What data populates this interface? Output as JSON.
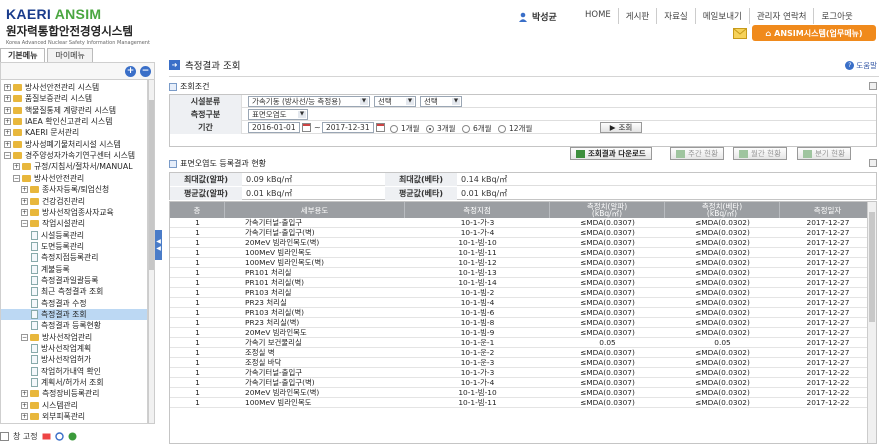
{
  "header": {
    "logo_main_kaeri": "KAERI",
    "logo_main_ansim": "ANSIM",
    "logo_kr": "원자력통합안전경영시스템",
    "logo_sub": "Korea Advanced Nuclear Safety Information Management",
    "user_name": "박성균",
    "nav": [
      "HOME",
      "게시판",
      "자료실",
      "메일보내기",
      "관리자 연락처",
      "로그아웃"
    ],
    "ansim_button": "ANSIM시스템(업무메뉴)"
  },
  "sidebar": {
    "tabs": [
      "기본메뉴",
      "마이메뉴"
    ],
    "add_label": "+",
    "remove_label": "−",
    "items": [
      {
        "label": "방사선안전관리 시스템",
        "indent": 0,
        "type": "folder",
        "toggle": "+"
      },
      {
        "label": "품질보증관리 시스템",
        "indent": 0,
        "type": "folder",
        "toggle": "+"
      },
      {
        "label": "핵물질통제 계량관리 시스템",
        "indent": 0,
        "type": "folder",
        "toggle": "+"
      },
      {
        "label": "IAEA 확인신고관리 시스템",
        "indent": 0,
        "type": "folder",
        "toggle": "+"
      },
      {
        "label": "KAERI 문서관리",
        "indent": 0,
        "type": "folder",
        "toggle": "+"
      },
      {
        "label": "방사성폐기물처리시설 시스템",
        "indent": 0,
        "type": "folder",
        "toggle": "+"
      },
      {
        "label": "경주양성자가속기연구센터 시스템",
        "indent": 0,
        "type": "folder",
        "toggle": "−"
      },
      {
        "label": "규정/지침서/절차서/MANUAL",
        "indent": 1,
        "type": "folder",
        "toggle": "+"
      },
      {
        "label": "방사선안전관리",
        "indent": 1,
        "type": "folder",
        "toggle": "−"
      },
      {
        "label": "종사자등록/퇴업신청",
        "indent": 2,
        "type": "folder",
        "toggle": "+"
      },
      {
        "label": "건강검진관리",
        "indent": 2,
        "type": "folder",
        "toggle": "+"
      },
      {
        "label": "방사선작업종사자교육",
        "indent": 2,
        "type": "folder",
        "toggle": "+"
      },
      {
        "label": "작업시설관리",
        "indent": 2,
        "type": "folder",
        "toggle": "−"
      },
      {
        "label": "시설등록관리",
        "indent": 3,
        "type": "doc"
      },
      {
        "label": "도면등록관리",
        "indent": 3,
        "type": "doc"
      },
      {
        "label": "측정지점등록관리",
        "indent": 3,
        "type": "doc"
      },
      {
        "label": "계불등록",
        "indent": 3,
        "type": "doc"
      },
      {
        "label": "측정결과일괄등록",
        "indent": 3,
        "type": "doc"
      },
      {
        "label": "최근 측정결과 조회",
        "indent": 3,
        "type": "doc"
      },
      {
        "label": "측정결과 수정",
        "indent": 3,
        "type": "doc"
      },
      {
        "label": "측정결과 조회",
        "indent": 3,
        "type": "doc",
        "selected": true
      },
      {
        "label": "측정결과 등록현황",
        "indent": 3,
        "type": "doc"
      },
      {
        "label": "방사선작업관리",
        "indent": 2,
        "type": "folder",
        "toggle": "−"
      },
      {
        "label": "방사선작업계획",
        "indent": 3,
        "type": "doc"
      },
      {
        "label": "방사선작업허가",
        "indent": 3,
        "type": "doc"
      },
      {
        "label": "작업허가내역 확인",
        "indent": 3,
        "type": "doc"
      },
      {
        "label": "계획서/허가서 조회",
        "indent": 3,
        "type": "doc"
      },
      {
        "label": "측정장비등록관리",
        "indent": 2,
        "type": "folder",
        "toggle": "+"
      },
      {
        "label": "시스템관리",
        "indent": 2,
        "type": "folder",
        "toggle": "+"
      },
      {
        "label": "외부피폭관리",
        "indent": 2,
        "type": "folder",
        "toggle": "+"
      }
    ],
    "footer_label": "창 고정"
  },
  "main": {
    "title": "측정결과 조회",
    "help": "도움말",
    "search_panel_title": "조회조건",
    "search": {
      "category_label": "시설분류",
      "category_value": "가속기동 (방사선/능 측정용)",
      "select2_value": "선택",
      "select3_value": "선택",
      "measure_label": "측정구분",
      "measure_value": "표면오염도",
      "period_label": "기간",
      "date_from": "2016-01-01",
      "date_to": "2017-12-31",
      "period_options": [
        "1개월",
        "3개월",
        "6개월",
        "12개월"
      ],
      "period_selected": "3개월",
      "search_button": "조회"
    },
    "actions": [
      "조회결과 다운로드",
      "주간 현황",
      "월간 현황",
      "분기 현황"
    ],
    "result_panel_title": "표면오염도 등록결과 현황",
    "summary": {
      "max_alpha_label": "최대값(알파)",
      "max_alpha_value": "0.09 kBq/㎡",
      "max_beta_label": "최대값(베타)",
      "max_beta_value": "0.14 kBq/㎡",
      "avg_alpha_label": "평균값(알파)",
      "avg_alpha_value": "0.01 kBq/㎡",
      "avg_beta_label": "평균값(베타)",
      "avg_beta_value": "0.01 kBq/㎡"
    },
    "table": {
      "headers": [
        "층",
        "세부용도",
        "측정지점",
        "측정치(알파)",
        "측정치(베타)",
        "측정일자"
      ],
      "header_units": [
        "",
        "",
        "",
        "(kBq/㎡)",
        "(kBq/㎡)",
        ""
      ],
      "rows": [
        [
          "1",
          "가속기터널-출입구",
          "10-1-가-3",
          "≤MDA(0.0307)",
          "≤MDA(0.0302)",
          "2017-12-27"
        ],
        [
          "1",
          "가속기터널-출입구(벽)",
          "10-1-가-4",
          "≤MDA(0.0307)",
          "≤MDA(0.0302)",
          "2017-12-27"
        ],
        [
          "1",
          "20MeV 빔라인복도(벽)",
          "10-1-빔-10",
          "≤MDA(0.0307)",
          "≤MDA(0.0302)",
          "2017-12-27"
        ],
        [
          "1",
          "100MeV 빔라인복도",
          "10-1-빔-11",
          "≤MDA(0.0307)",
          "≤MDA(0.0302)",
          "2017-12-27"
        ],
        [
          "1",
          "100MeV 빔라인복도(벽)",
          "10-1-빔-12",
          "≤MDA(0.0307)",
          "≤MDA(0.0302)",
          "2017-12-27"
        ],
        [
          "1",
          "PR101 처리실",
          "10-1-빔-13",
          "≤MDA(0.0307)",
          "≤MDA(0.0302)",
          "2017-12-27"
        ],
        [
          "1",
          "PR101 처리실(벽)",
          "10-1-빔-14",
          "≤MDA(0.0307)",
          "≤MDA(0.0302)",
          "2017-12-27"
        ],
        [
          "1",
          "PR103 처리실",
          "10-1-빔-2",
          "≤MDA(0.0307)",
          "≤MDA(0.0302)",
          "2017-12-27"
        ],
        [
          "1",
          "PR23 처리실",
          "10-1-빔-4",
          "≤MDA(0.0307)",
          "≤MDA(0.0302)",
          "2017-12-27"
        ],
        [
          "1",
          "PR103 처리실(벽)",
          "10-1-빔-6",
          "≤MDA(0.0307)",
          "≤MDA(0.0302)",
          "2017-12-27"
        ],
        [
          "1",
          "PR23 처리실(벽)",
          "10-1-빔-8",
          "≤MDA(0.0307)",
          "≤MDA(0.0302)",
          "2017-12-27"
        ],
        [
          "1",
          "20MeV 빔라인복도",
          "10-1-빔-9",
          "≤MDA(0.0307)",
          "≤MDA(0.0302)",
          "2017-12-27"
        ],
        [
          "1",
          "가속기 보건물리실",
          "10-1-운-1",
          "0.05",
          "0.05",
          "2017-12-27"
        ],
        [
          "1",
          "조정실 벽",
          "10-1-운-2",
          "≤MDA(0.0307)",
          "≤MDA(0.0302)",
          "2017-12-27"
        ],
        [
          "1",
          "조정실 바닥",
          "10-1-운-3",
          "≤MDA(0.0307)",
          "≤MDA(0.0302)",
          "2017-12-27"
        ],
        [
          "1",
          "가속기터널-출입구",
          "10-1-가-3",
          "≤MDA(0.0307)",
          "≤MDA(0.0302)",
          "2017-12-22"
        ],
        [
          "1",
          "가속기터널-출입구(벽)",
          "10-1-가-4",
          "≤MDA(0.0307)",
          "≤MDA(0.0302)",
          "2017-12-22"
        ],
        [
          "1",
          "20MeV 빔라인복도(벽)",
          "10-1-빔-10",
          "≤MDA(0.0307)",
          "≤MDA(0.0302)",
          "2017-12-22"
        ],
        [
          "1",
          "100MeV 빔라인복도",
          "10-1-빔-11",
          "≤MDA(0.0307)",
          "≤MDA(0.0302)",
          "2017-12-22"
        ]
      ]
    }
  }
}
